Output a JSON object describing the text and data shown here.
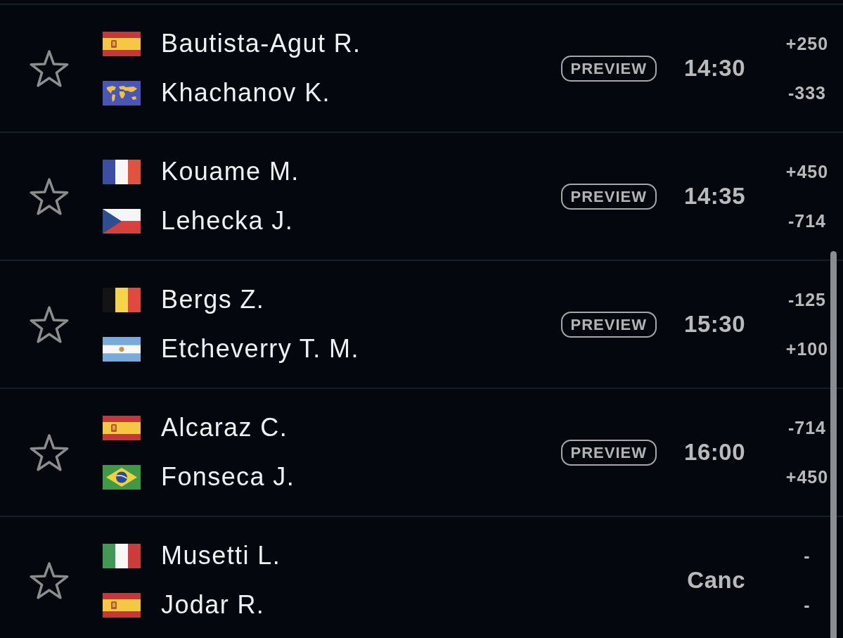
{
  "matches": [
    {
      "starred": false,
      "players": [
        {
          "flag": {
            "kind": "spain"
          },
          "name": "Bautista-Agut R.",
          "odds": "+250"
        },
        {
          "flag": {
            "kind": "world"
          },
          "name": "Khachanov K.",
          "odds": "-333"
        }
      ],
      "preview": "PREVIEW",
      "status": "14:30"
    },
    {
      "starred": false,
      "players": [
        {
          "flag": {
            "kind": "france"
          },
          "name": "Kouame M.",
          "odds": "+450"
        },
        {
          "flag": {
            "kind": "czech"
          },
          "name": "Lehecka J.",
          "odds": "-714"
        }
      ],
      "preview": "PREVIEW",
      "status": "14:35"
    },
    {
      "starred": false,
      "players": [
        {
          "flag": {
            "kind": "belgium"
          },
          "name": "Bergs Z.",
          "odds": "-125"
        },
        {
          "flag": {
            "kind": "argentina"
          },
          "name": "Etcheverry T. M.",
          "odds": "+100"
        }
      ],
      "preview": "PREVIEW",
      "status": "15:30"
    },
    {
      "starred": false,
      "players": [
        {
          "flag": {
            "kind": "spain"
          },
          "name": "Alcaraz C.",
          "odds": "-714"
        },
        {
          "flag": {
            "kind": "brazil"
          },
          "name": "Fonseca J.",
          "odds": "+450"
        }
      ],
      "preview": "PREVIEW",
      "status": "16:00"
    },
    {
      "starred": false,
      "players": [
        {
          "flag": {
            "kind": "italy"
          },
          "name": "Musetti L.",
          "odds": "-"
        },
        {
          "flag": {
            "kind": "spain"
          },
          "name": "Jodar R.",
          "odds": "-"
        }
      ],
      "status": "Canc"
    }
  ]
}
